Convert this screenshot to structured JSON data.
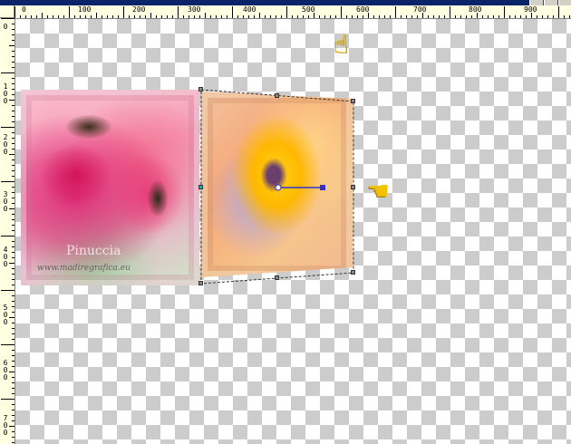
{
  "rulers": {
    "horizontal_labels": [
      "0",
      "100",
      "200",
      "300",
      "400",
      "500",
      "600",
      "700",
      "800",
      "900"
    ],
    "vertical_labels": [
      "0",
      "100",
      "200",
      "300",
      "400",
      "500",
      "600",
      "700"
    ]
  },
  "canvas": {
    "watermark_title": "Pinuccia",
    "watermark_url": "www.madiregrafica.eu"
  },
  "icons": {
    "hand_pointing_up": "hand-pointing-up-icon",
    "hand_pointing_left": "hand-pointing-left-icon"
  },
  "colors": {
    "ruler_bg": "#ffffe1",
    "checker_light": "#ffffff",
    "checker_dark": "#cccccc",
    "selection_line": "#3333cc",
    "title_bar": "#0a246a"
  }
}
